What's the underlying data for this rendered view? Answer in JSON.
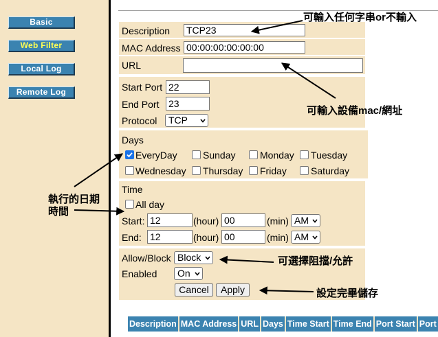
{
  "sidebar": {
    "items": [
      {
        "label": "Basic"
      },
      {
        "label": "Web Filter",
        "active": true
      },
      {
        "label": "Local Log"
      },
      {
        "label": "Remote Log"
      }
    ]
  },
  "form": {
    "description": {
      "label": "Description",
      "value": "TCP23"
    },
    "mac": {
      "label": "MAC Address",
      "value": "00:00:00:00:00:00"
    },
    "url": {
      "label": "URL",
      "value": ""
    },
    "start_port": {
      "label": "Start Port",
      "value": "22"
    },
    "end_port": {
      "label": "End Port",
      "value": "23"
    },
    "protocol": {
      "label": "Protocol",
      "value": "TCP"
    },
    "days": {
      "label": "Days",
      "options": [
        {
          "label": "EveryDay",
          "checked": true
        },
        {
          "label": "Sunday",
          "checked": false
        },
        {
          "label": "Monday",
          "checked": false
        },
        {
          "label": "Tuesday",
          "checked": false
        },
        {
          "label": "Wednesday",
          "checked": false
        },
        {
          "label": "Thursday",
          "checked": false
        },
        {
          "label": "Friday",
          "checked": false
        },
        {
          "label": "Saturday",
          "checked": false
        }
      ]
    },
    "time": {
      "label": "Time",
      "all_day": {
        "label": "All day",
        "checked": false
      },
      "start": {
        "label": "Start:",
        "hour": "12",
        "min": "00",
        "ampm": "AM"
      },
      "end": {
        "label": "End:",
        "hour": "12",
        "min": "00",
        "ampm": "AM"
      },
      "hour_unit": "(hour)",
      "min_unit": "(min)"
    },
    "allow_block": {
      "label": "Allow/Block",
      "value": "Block"
    },
    "enabled": {
      "label": "Enabled",
      "value": "On"
    },
    "cancel_label": "Cancel",
    "apply_label": "Apply"
  },
  "annotations": {
    "description_note": "可輸入任何字串or不輸入",
    "mac_url_note": "可輸入設備mac/網址",
    "schedule_note_line1": "執行的日期",
    "schedule_note_line2": "時間",
    "block_note": "可選擇阻擋/允許",
    "save_note": "設定完畢儲存"
  },
  "table": {
    "headers": [
      "Description",
      "MAC Address",
      "URL",
      "Days",
      "Time Start",
      "Time End",
      "Port Start",
      "Port End"
    ]
  },
  "colors": {
    "panel": "#f5e5c5",
    "nav_button": "#3b83b0",
    "active_nav_text": "#ffff55",
    "header_cell": "#3b83b0"
  }
}
